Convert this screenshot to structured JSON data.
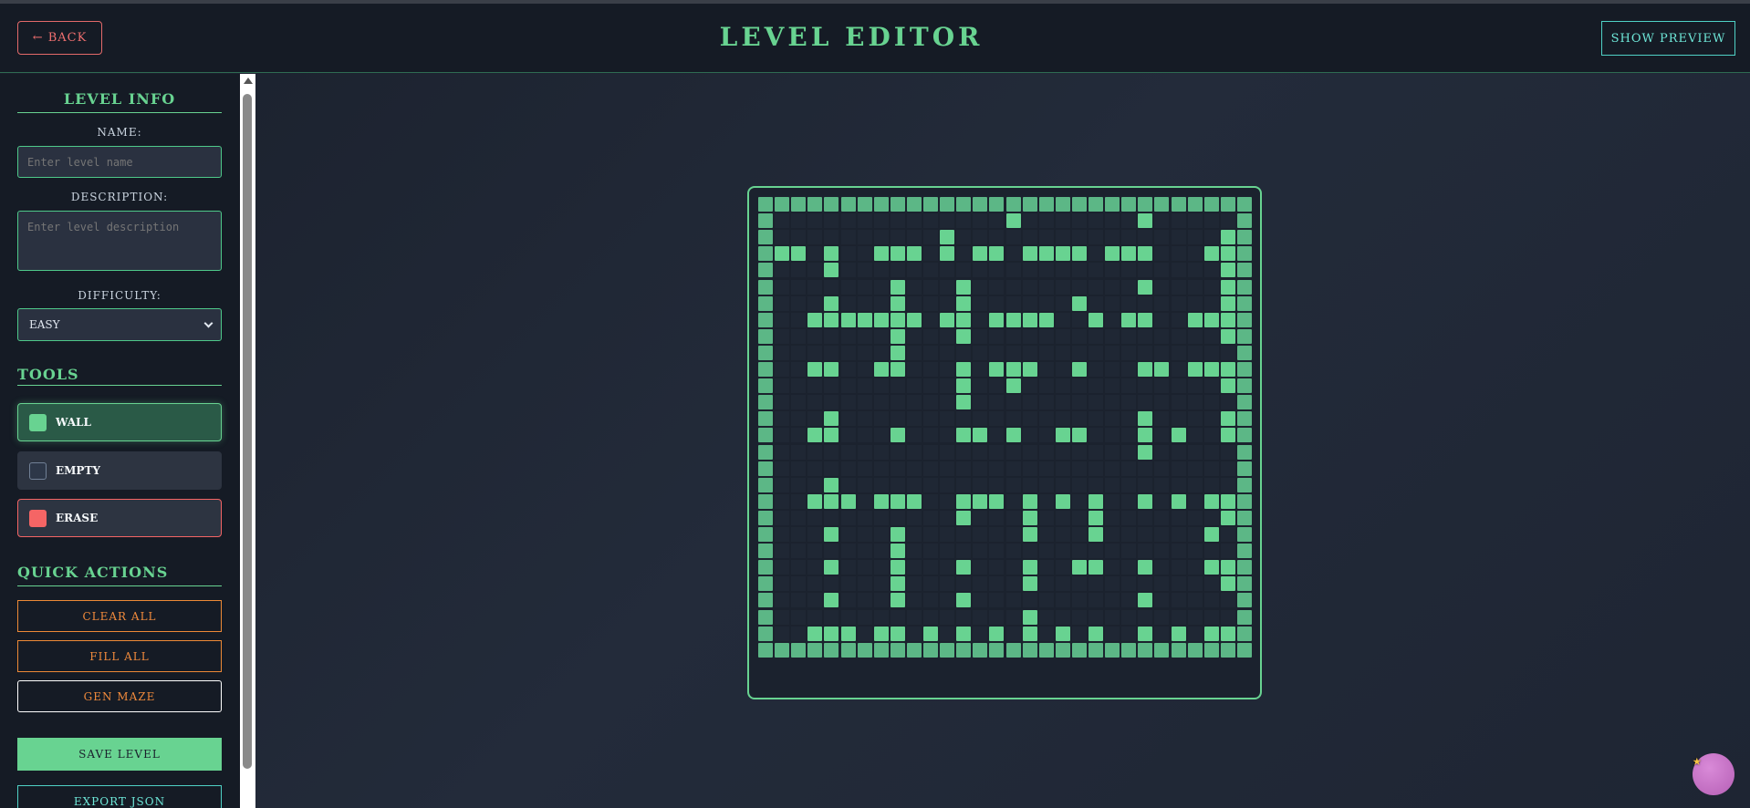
{
  "header": {
    "back_label": "← BACK",
    "title": "LEVEL EDITOR",
    "preview_label": "SHOW PREVIEW"
  },
  "sidebar": {
    "level_info": {
      "title": "LEVEL INFO",
      "name_label": "NAME:",
      "name_placeholder": "Enter level name",
      "name_value": "",
      "description_label": "DESCRIPTION:",
      "description_placeholder": "Enter level description",
      "description_value": "",
      "difficulty_label": "DIFFICULTY:",
      "difficulty_value": "EASY"
    },
    "tools": {
      "title": "TOOLS",
      "items": [
        {
          "label": "WALL",
          "color": "#68d391",
          "selected": true
        },
        {
          "label": "EMPTY",
          "color": "#2d3748",
          "selected": false
        },
        {
          "label": "ERASE",
          "color": "#f56565",
          "selected": false
        }
      ]
    },
    "quick_actions": {
      "title": "QUICK ACTIONS",
      "clear_label": "CLEAR ALL",
      "fill_label": "FILL ALL",
      "maze_label": "GEN MAZE"
    },
    "save_label": "SAVE LEVEL",
    "export_label": "EXPORT JSON"
  },
  "colors": {
    "accent": "#68d391",
    "danger": "#f56565",
    "warning": "#ed8936",
    "info": "#4fd1c5"
  },
  "grid": {
    "columns": 30,
    "rows": 30,
    "wall_map": [
      "111111111111111111111111111111",
      "100000000000000100000001000001",
      "100000000001000000000000000011",
      "111040011101011011110111000111",
      "100040000000000000000000000011",
      "100000001000100000000001000011",
      "100010001000100000010000000011",
      "100111111101101111001011001111",
      "100000001000100000000000000011",
      "100000001000000000000000000001",
      "100110011000101110010001101111",
      "100000000000100100000000000011",
      "100000000000100000000000000001",
      "100010000000000000000001000011",
      "100110001000110100110001010011",
      "100000000000000000000001000001",
      "100000000000000000000000000001",
      "100010000000000000000000000001",
      "100111011100111010101001010111",
      "100000000000100010001000000011",
      "100010001000000010001000000101",
      "100000001000000000000000000001",
      "100010001000100010011001000111",
      "100000001000000010000000000011",
      "100010001000100000000001000001",
      "100000000000000010000000000001",
      "100111011010101010101001010111",
      "111111111111111111111111111111"
    ]
  },
  "assistant_icon": "assistant-star-icon"
}
